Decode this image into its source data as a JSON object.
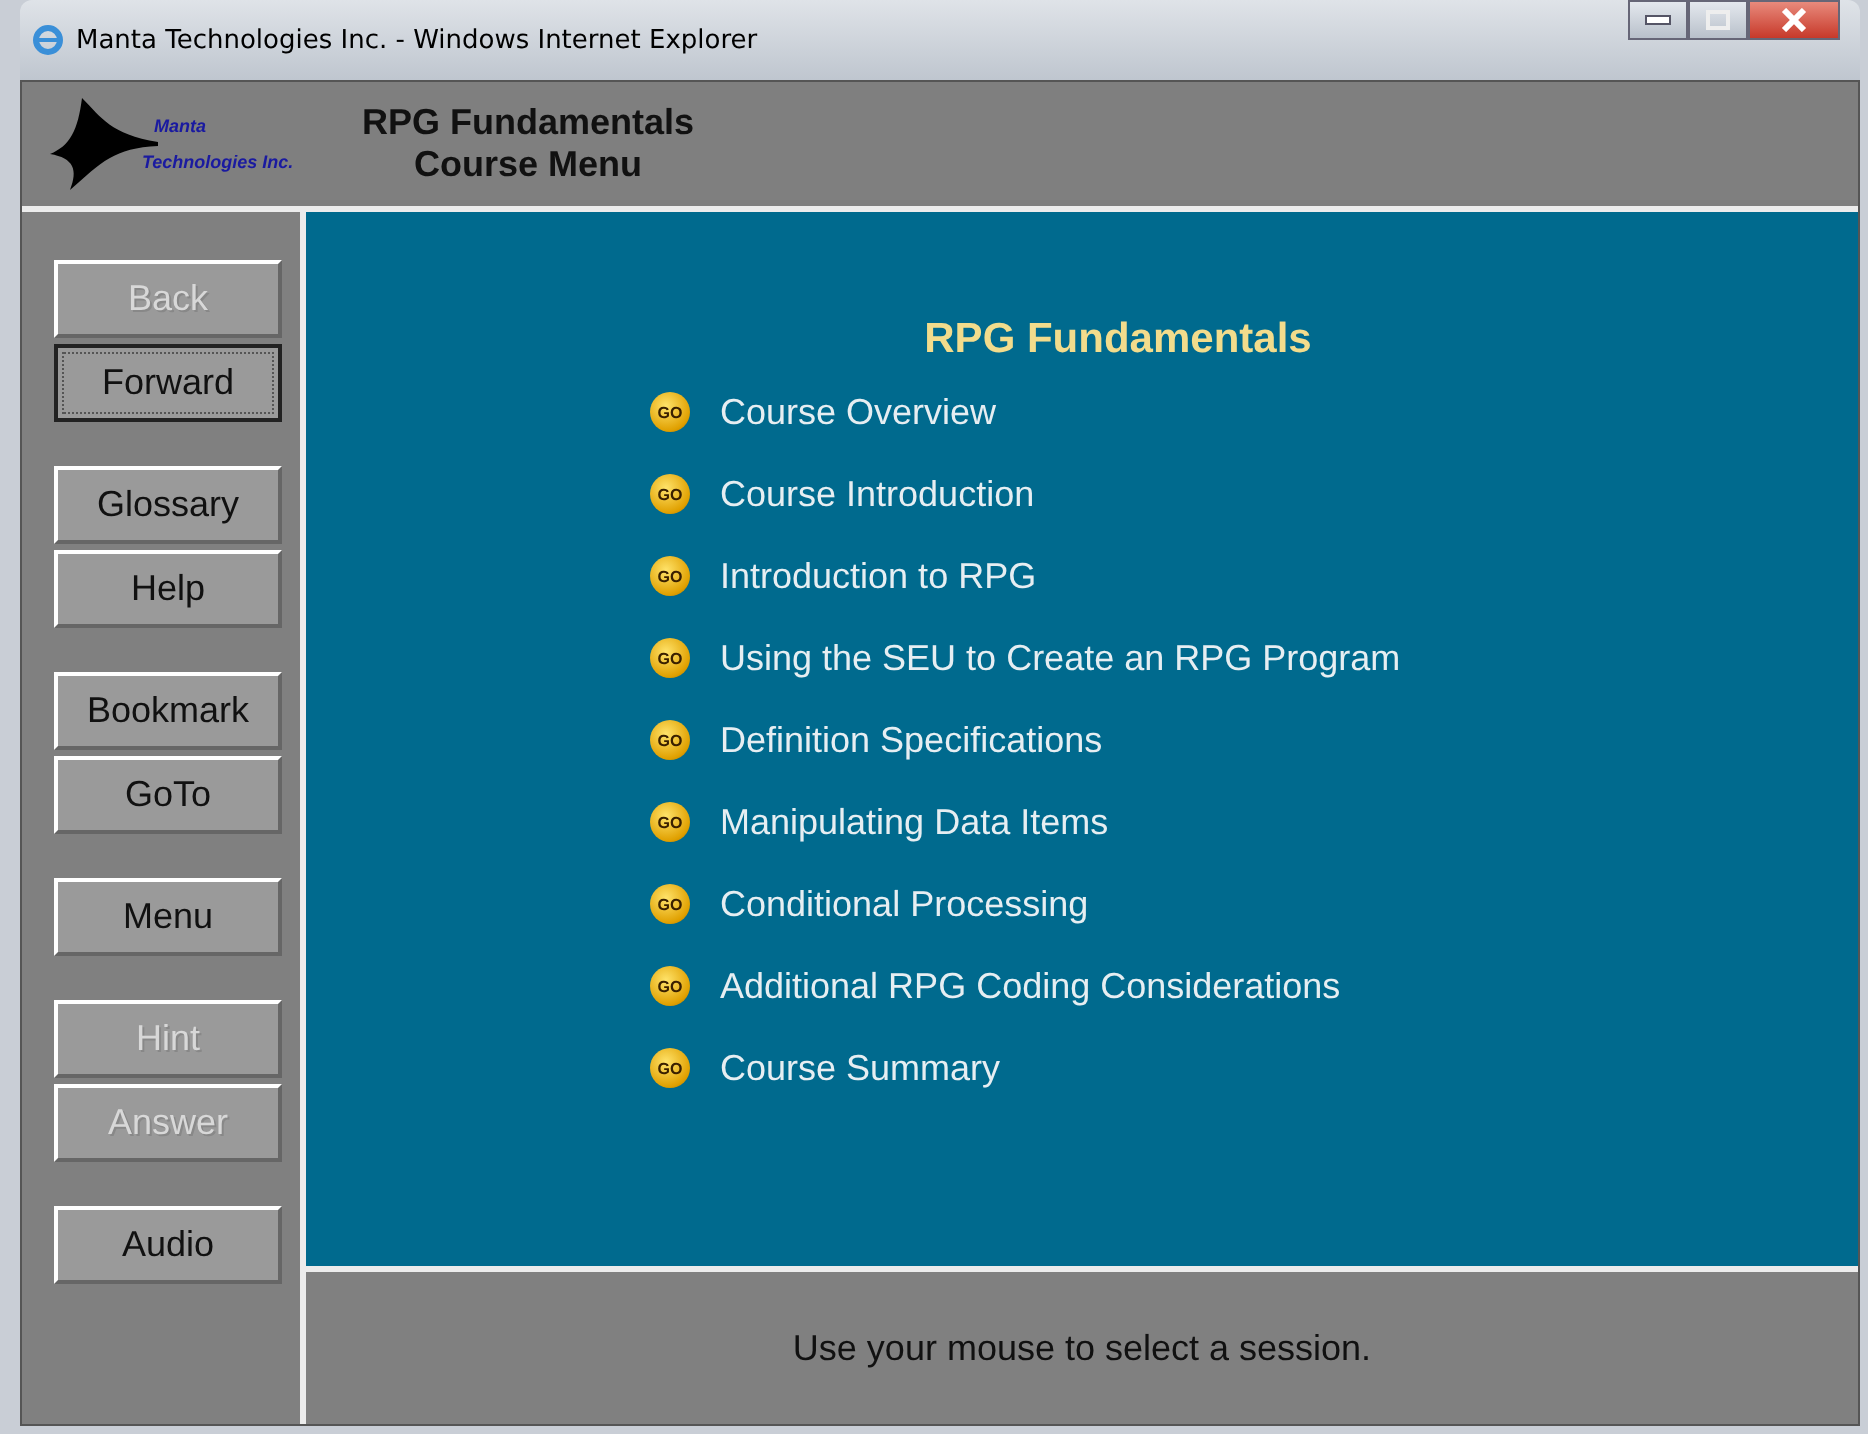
{
  "window": {
    "title": "Manta Technologies Inc. - Windows Internet Explorer"
  },
  "header": {
    "logo_line_1": "Manta",
    "logo_line_2": "Technologies Inc.",
    "title_line_1": "RPG Fundamentals",
    "title_line_2": "Course Menu"
  },
  "sidebar": {
    "groups": [
      [
        {
          "label": "Back",
          "disabled": true,
          "focused": false
        },
        {
          "label": "Forward",
          "disabled": false,
          "focused": true
        }
      ],
      [
        {
          "label": "Glossary",
          "disabled": false,
          "focused": false
        },
        {
          "label": "Help",
          "disabled": false,
          "focused": false
        }
      ],
      [
        {
          "label": "Bookmark",
          "disabled": false,
          "focused": false
        },
        {
          "label": "GoTo",
          "disabled": false,
          "focused": false
        }
      ],
      [
        {
          "label": "Menu",
          "disabled": false,
          "focused": false
        }
      ],
      [
        {
          "label": "Hint",
          "disabled": true,
          "focused": false
        },
        {
          "label": "Answer",
          "disabled": true,
          "focused": false
        }
      ],
      [
        {
          "label": "Audio",
          "disabled": false,
          "focused": false
        }
      ]
    ]
  },
  "content": {
    "heading": "RPG Fundamentals",
    "items": [
      {
        "badge": "GO",
        "label": "Course Overview"
      },
      {
        "badge": "GO",
        "label": "Course Introduction"
      },
      {
        "badge": "GO",
        "label": "Introduction to RPG"
      },
      {
        "badge": "GO",
        "label": "Using the SEU to Create an RPG Program"
      },
      {
        "badge": "GO",
        "label": "Definition Specifications"
      },
      {
        "badge": "GO",
        "label": "Manipulating Data Items"
      },
      {
        "badge": "GO",
        "label": "Conditional Processing"
      },
      {
        "badge": "GO",
        "label": "Additional RPG Coding Considerations"
      },
      {
        "badge": "GO",
        "label": "Course Summary"
      }
    ]
  },
  "status": "Use your mouse to select a session."
}
